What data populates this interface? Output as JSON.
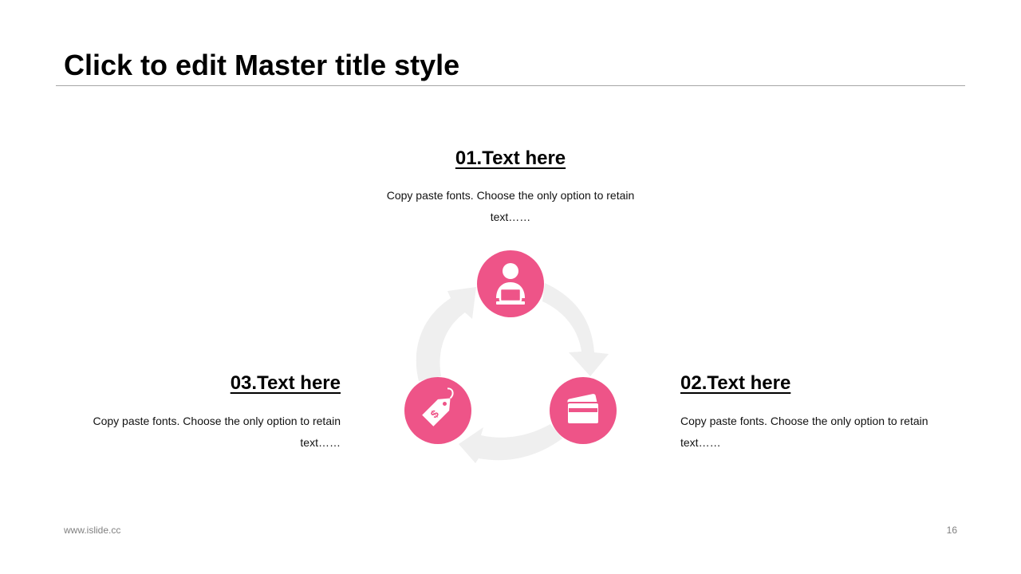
{
  "slide": {
    "title": "Click to edit Master title style",
    "footer_url": "www.islide.cc",
    "page_number": "16"
  },
  "accent_color": "#EE5488",
  "cycle_arrow_color": "#EFEFEF",
  "items": [
    {
      "heading": "01.Text here",
      "description": "Copy paste fonts. Choose the only option to retain text……",
      "icon": "person-laptop-icon"
    },
    {
      "heading": "02.Text here",
      "description": "Copy paste fonts. Choose the only option to retain text……",
      "icon": "credit-card-icon"
    },
    {
      "heading": "03.Text here",
      "description": "Copy paste fonts. Choose the only option to retain text……",
      "icon": "price-tag-icon"
    }
  ]
}
